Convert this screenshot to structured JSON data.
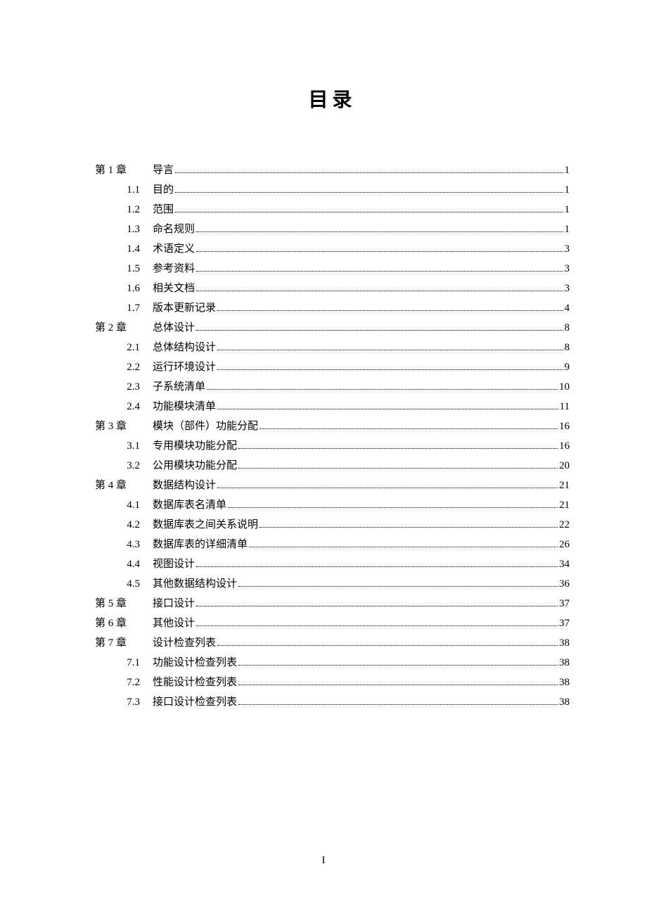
{
  "title": "目录",
  "pageNumber": "I",
  "entries": [
    {
      "number": "第 1 章",
      "level": "chapter",
      "title": "导言",
      "page": "1"
    },
    {
      "number": "1.1",
      "level": "section",
      "title": "目的",
      "page": "1"
    },
    {
      "number": "1.2",
      "level": "section",
      "title": "范围",
      "page": "1"
    },
    {
      "number": "1.3",
      "level": "section",
      "title": "命名规则",
      "page": "1"
    },
    {
      "number": "1.4",
      "level": "section",
      "title": "术语定义",
      "page": "3"
    },
    {
      "number": "1.5",
      "level": "section",
      "title": "参考资料",
      "page": "3"
    },
    {
      "number": "1.6",
      "level": "section",
      "title": "相关文档",
      "page": "3"
    },
    {
      "number": "1.7",
      "level": "section",
      "title": "版本更新记录",
      "page": "4"
    },
    {
      "number": "第 2 章",
      "level": "chapter",
      "title": "总体设计",
      "page": "8"
    },
    {
      "number": "2.1",
      "level": "section",
      "title": "总体结构设计",
      "page": "8"
    },
    {
      "number": "2.2",
      "level": "section",
      "title": "运行环境设计",
      "page": "9"
    },
    {
      "number": "2.3",
      "level": "section",
      "title": "子系统清单",
      "page": "10"
    },
    {
      "number": "2.4",
      "level": "section",
      "title": "功能模块清单",
      "page": "11"
    },
    {
      "number": "第 3 章",
      "level": "chapter",
      "title": "模块（部件）功能分配",
      "page": "16"
    },
    {
      "number": "3.1",
      "level": "section",
      "title": "专用模块功能分配",
      "page": "16"
    },
    {
      "number": "3.2",
      "level": "section",
      "title": "公用模块功能分配",
      "page": "20"
    },
    {
      "number": "第 4 章",
      "level": "chapter",
      "title": "数据结构设计",
      "page": "21"
    },
    {
      "number": "4.1",
      "level": "section",
      "title": "数据库表名清单",
      "page": "21"
    },
    {
      "number": "4.2",
      "level": "section",
      "title": "数据库表之间关系说明",
      "page": "22"
    },
    {
      "number": "4.3",
      "level": "section",
      "title": "数据库表的详细清单",
      "page": "26"
    },
    {
      "number": "4.4",
      "level": "section",
      "title": "视图设计",
      "page": "34"
    },
    {
      "number": "4.5",
      "level": "section",
      "title": "其他数据结构设计",
      "page": "36"
    },
    {
      "number": "第 5 章",
      "level": "chapter",
      "title": "接口设计",
      "page": "37"
    },
    {
      "number": "第 6 章",
      "level": "chapter",
      "title": "其他设计",
      "page": "37"
    },
    {
      "number": "第 7 章",
      "level": "chapter",
      "title": "设计检查列表",
      "page": "38"
    },
    {
      "number": "7.1",
      "level": "section",
      "title": "功能设计检查列表",
      "page": "38"
    },
    {
      "number": "7.2",
      "level": "section",
      "title": "性能设计检查列表",
      "page": "38"
    },
    {
      "number": "7.3",
      "level": "section",
      "title": "接口设计检查列表",
      "page": "38"
    }
  ]
}
